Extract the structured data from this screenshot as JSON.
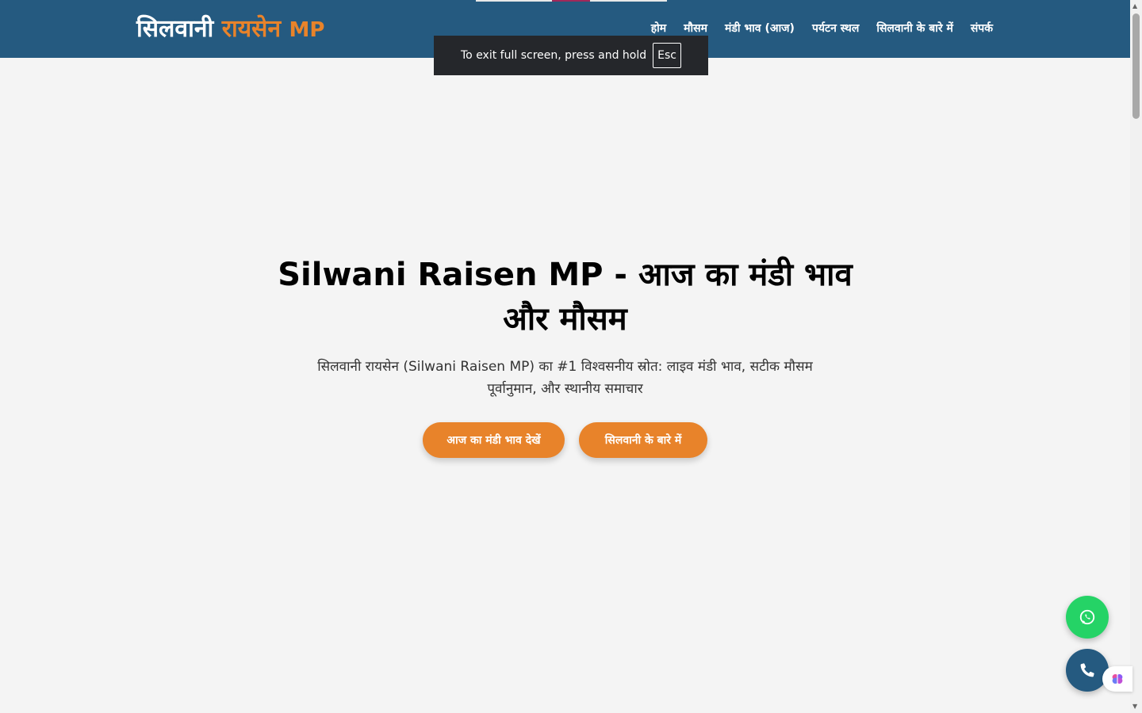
{
  "site": {
    "logo_main": "सिलवानी",
    "logo_accent": "रायसेन",
    "logo_suffix": "MP"
  },
  "nav": {
    "items": [
      {
        "label": "होम"
      },
      {
        "label": "मौसम"
      },
      {
        "label": "मंडी भाव (आज)"
      },
      {
        "label": "पर्यटन स्थल"
      },
      {
        "label": "सिलवानी के बारे में"
      },
      {
        "label": "संपर्क"
      }
    ]
  },
  "fullscreen_toast": {
    "text": "To exit full screen, press and hold",
    "key": "Esc"
  },
  "hero": {
    "title": "Silwani Raisen MP - आज का मंडी भाव और मौसम",
    "subtitle": "सिलवानी रायसेन (Silwani Raisen MP) का #1 विश्वसनीय स्रोत: लाइव मंडी भाव, सटीक मौसम पूर्वानुमान, और स्थानीय समाचार",
    "primary_button": "आज का मंडी भाव देखें",
    "secondary_button": "सिलवानी के बारे में"
  },
  "floating": {
    "whatsapp_icon": "whatsapp-icon",
    "phone_icon": "phone-icon",
    "extension_icon": "brain-icon"
  },
  "colors": {
    "header_bg": "#255a80",
    "accent": "#e8832a",
    "page_bg": "#f4f4f4",
    "whatsapp": "#25d366"
  }
}
